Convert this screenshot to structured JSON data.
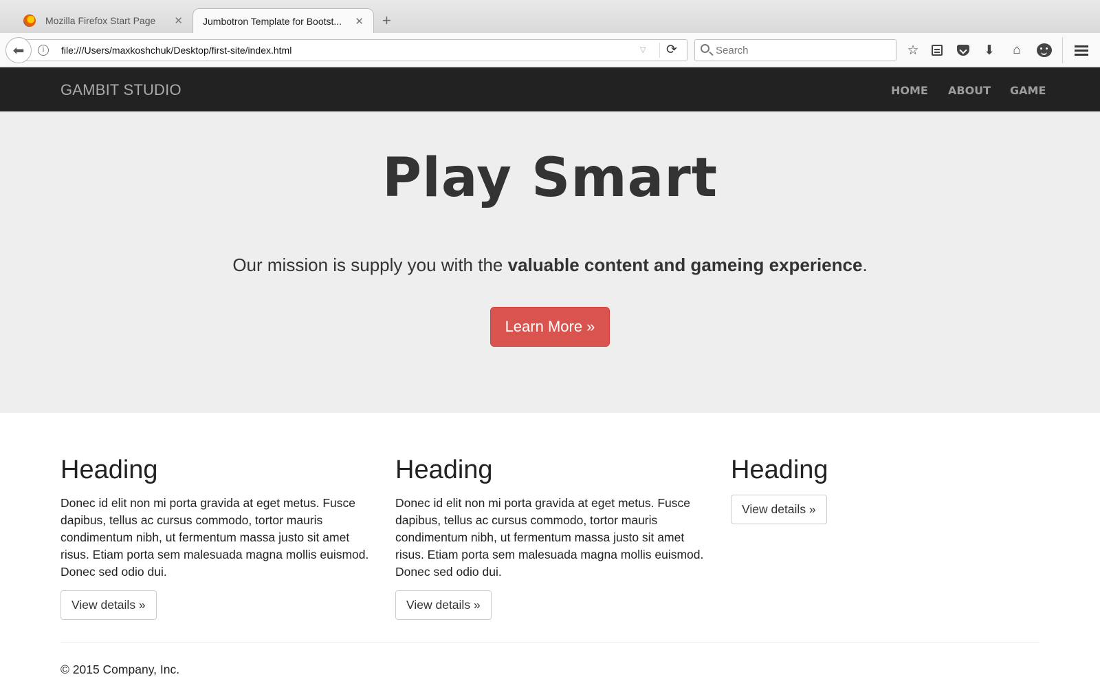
{
  "browser": {
    "tabs": [
      {
        "label": "Mozilla Firefox Start Page",
        "close": "✕"
      },
      {
        "label": "Jumbotron Template for Bootst...",
        "close": "✕"
      }
    ],
    "new_tab": "+",
    "url": "file:///Users/maxkoshchuk/Desktop/first-site/index.html",
    "search_placeholder": "Search",
    "icons": {
      "back": "arrow-left-icon",
      "info": "info-icon",
      "reload": "reload-icon",
      "bookmark": "star-icon",
      "reader": "reading-list-icon",
      "pocket": "pocket-icon",
      "download": "download-icon",
      "home": "home-icon",
      "hello": "hello-icon",
      "menu": "hamburger-menu-icon"
    }
  },
  "site": {
    "brand": "GAMBIT STUDIO",
    "nav": [
      "HOME",
      "ABOUT",
      "GAME"
    ],
    "jumbotron": {
      "title": "Play Smart",
      "lead_start": "Our mission is supply you with the ",
      "lead_bold": "valuable content and gameing experience",
      "lead_end": ".",
      "button": "Learn More »",
      "button_color": "#d9534f"
    },
    "columns": [
      {
        "heading": "Heading",
        "text": "Donec id elit non mi porta gravida at eget metus. Fusce dapibus, tellus ac cursus commodo, tortor mauris condimentum nibh, ut fermentum massa justo sit amet risus. Etiam porta sem malesuada magna mollis euismod. Donec sed odio dui.",
        "button": "View details »"
      },
      {
        "heading": "Heading",
        "text": "Donec id elit non mi porta gravida at eget metus. Fusce dapibus, tellus ac cursus commodo, tortor mauris condimentum nibh, ut fermentum massa justo sit amet risus. Etiam porta sem malesuada magna mollis euismod. Donec sed odio dui.",
        "button": "View details »"
      },
      {
        "heading": "Heading",
        "text": "",
        "button": "View details »"
      }
    ],
    "footer": "© 2015 Company, Inc."
  }
}
